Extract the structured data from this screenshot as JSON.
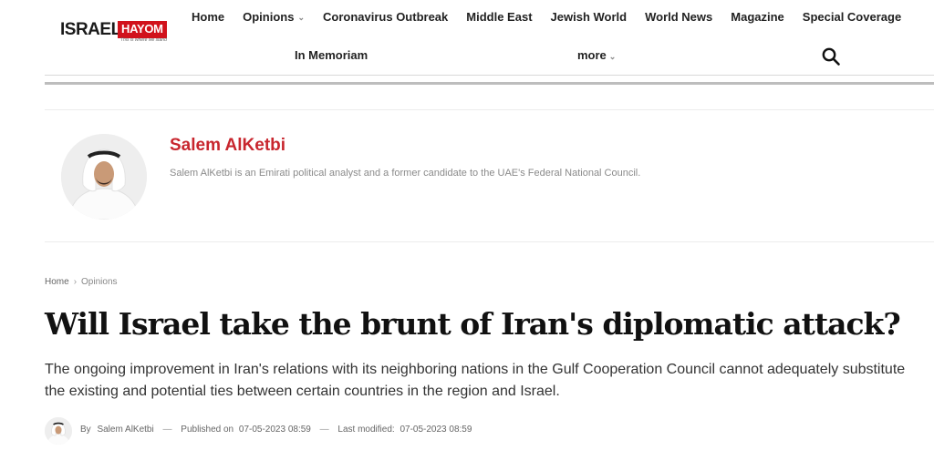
{
  "brand": {
    "name_part1": "ISRAEL",
    "name_part2": "HAYOM",
    "tagline": "This is where we stand"
  },
  "nav": {
    "items": [
      "Home",
      "Opinions",
      "Coronavirus Outbreak",
      "Middle East",
      "Jewish World",
      "World News",
      "Magazine",
      "Special Coverage"
    ],
    "row2": [
      "In Memoriam",
      "more"
    ],
    "icons": {
      "dropdown": "chevron-down-icon",
      "search": "search-icon"
    }
  },
  "author": {
    "name": "Salem AlKetbi",
    "bio": "Salem AlKetbi is an Emirati political analyst and a former candidate to the UAE's Federal National Council."
  },
  "breadcrumb": {
    "home": "Home",
    "current": "Opinions"
  },
  "article": {
    "headline": "Will Israel take the brunt of Iran's diplomatic attack?",
    "dek": "The ongoing improvement in Iran's relations with its neighboring nations in the Gulf Cooperation Council cannot adequately substitute the existing and potential ties between certain countries in the region and Israel."
  },
  "byline": {
    "by": "By",
    "author": "Salem AlKetbi",
    "sep": "—",
    "published_label": "Published on",
    "published": "07-05-2023 08:59",
    "modified_label": "Last modified:",
    "modified": "07-05-2023 08:59"
  },
  "colors": {
    "brand_red": "#d1121c",
    "author_red": "#c8262e"
  }
}
